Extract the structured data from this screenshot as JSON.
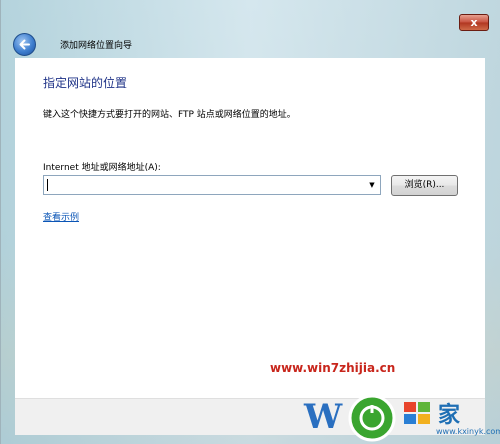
{
  "window": {
    "title": "添加网络位置向导",
    "close_glyph": "x"
  },
  "page": {
    "heading": "指定网站的位置",
    "description": "键入这个快捷方式要打开的网站、FTP 站点或网络位置的地址。",
    "field_label": "Internet 地址或网络地址(A):",
    "address_value": "",
    "browse_label": "浏览(R)...",
    "example_link": "查看示例"
  },
  "watermark": {
    "url": "www.win7zhijia.cn",
    "logo_site": "www.kxinyk.com"
  },
  "icons": {
    "back": "back-arrow-icon",
    "dropdown": "chevron-down-icon"
  },
  "colors": {
    "heading": "#1e3287",
    "link": "#0b55b6",
    "close_button": "#c85240",
    "watermark": "#c8261c"
  }
}
